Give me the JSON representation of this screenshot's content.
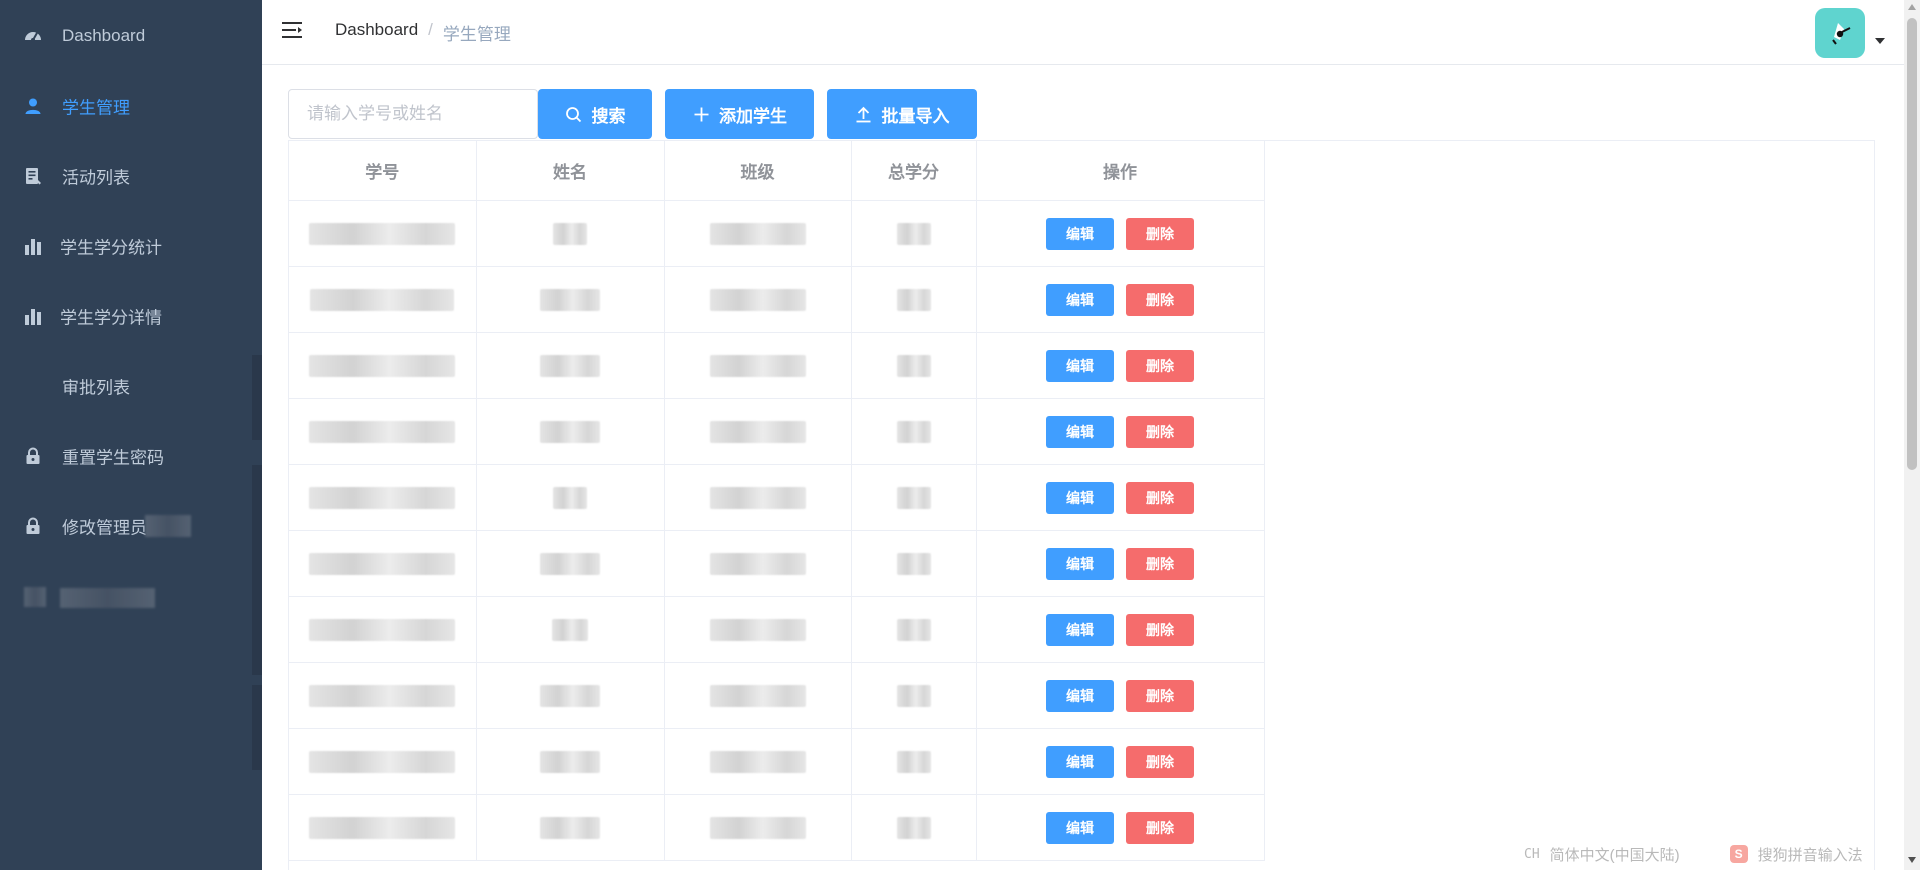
{
  "sidebar": {
    "items": [
      {
        "label": "Dashboard",
        "icon": "dashboard-icon",
        "active": false
      },
      {
        "label": "学生管理",
        "icon": "user-icon",
        "active": true
      },
      {
        "label": "活动列表",
        "icon": "document-icon",
        "active": false
      },
      {
        "label": "学生学分统计",
        "icon": "bar-chart-icon",
        "active": false
      },
      {
        "label": "学生学分详情",
        "icon": "bar-chart-icon",
        "active": false
      },
      {
        "label": "审批列表",
        "icon": "",
        "active": false
      },
      {
        "label": "重置学生密码",
        "icon": "lock-icon",
        "active": false
      },
      {
        "label": "修改管理员",
        "icon": "lock-icon",
        "active": false
      }
    ]
  },
  "header": {
    "breadcrumb": {
      "home": "Dashboard",
      "separator": "/",
      "current": "学生管理"
    }
  },
  "toolbar": {
    "search_placeholder": "请输入学号或姓名",
    "search_value": "",
    "search_button": "搜索",
    "add_button": "添加学生",
    "import_button": "批量导入"
  },
  "table": {
    "columns": [
      "学号",
      "姓名",
      "班级",
      "总学分",
      "操作"
    ],
    "edit_label": "编辑",
    "delete_label": "删除",
    "visible_row_count": 10
  },
  "ime": {
    "code": "CH",
    "lang": "简体中文(中国大陆)",
    "logo": "S",
    "name": "搜狗拼音输入法"
  },
  "colors": {
    "sidebar_bg": "#304156",
    "sidebar_text": "#bfcbd9",
    "active": "#409eff",
    "primary": "#409eff",
    "danger": "#f56c6c",
    "avatar_bg": "#5fd4cf"
  }
}
